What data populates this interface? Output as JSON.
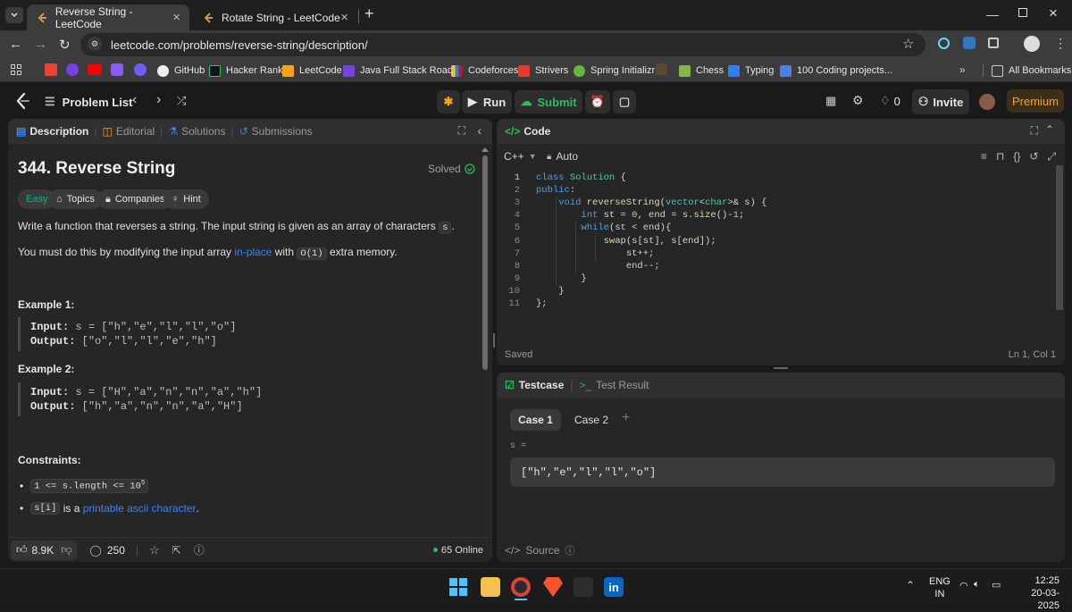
{
  "browser": {
    "tabs": [
      {
        "title": "Reverse String - LeetCode",
        "active": true
      },
      {
        "title": "Rotate String - LeetCode",
        "active": false
      }
    ],
    "url": "leetcode.com/problems/reverse-string/description/",
    "bookmarks": [
      "GitHub",
      "Hacker Rank",
      "LeetCode",
      "Java Full Stack Road...",
      "Codeforces",
      "Strivers",
      "Spring Initializr",
      "Chess",
      "Typing",
      "100 Coding projects..."
    ],
    "all_bookmarks": "All Bookmarks"
  },
  "lc": {
    "problem_list": "Problem List",
    "run": "Run",
    "submit": "Submit",
    "streak": "0",
    "invite": "Invite",
    "premium": "Premium"
  },
  "left": {
    "tabs": [
      "Description",
      "Editorial",
      "Solutions",
      "Submissions"
    ],
    "title": "344. Reverse String",
    "solved": "Solved",
    "tags": {
      "difficulty": "Easy",
      "topics": "Topics",
      "companies": "Companies",
      "hint": "Hint"
    },
    "p1_before": "Write a function that reverses a string. The input string is given as an array of characters ",
    "p1_code": "s",
    "p1_after": ".",
    "p2_before": "You must do this by modifying the input array ",
    "p2_link": "in-place",
    "p2_mid": " with ",
    "p2_code": "O(1)",
    "p2_after": " extra memory.",
    "ex1_title": "Example 1:",
    "ex1_input_label": "Input:",
    "ex1_input": "s = [\"h\",\"e\",\"l\",\"l\",\"o\"]",
    "ex1_output_label": "Output:",
    "ex1_output": "[\"o\",\"l\",\"l\",\"e\",\"h\"]",
    "ex2_title": "Example 2:",
    "ex2_input_label": "Input:",
    "ex2_input": "s = [\"H\",\"a\",\"n\",\"n\",\"a\",\"h\"]",
    "ex2_output_label": "Output:",
    "ex2_output": "[\"h\",\"a\",\"n\",\"n\",\"a\",\"H\"]",
    "constraints_title": "Constraints:",
    "c1": "1 <= s.length <= 10",
    "c1_sup": "5",
    "c2_code": "s[i]",
    "c2_mid": " is a ",
    "c2_link": "printable ascii character",
    "c2_after": ".",
    "likes": "8.9K",
    "comments": "250",
    "online": "65 Online"
  },
  "editor": {
    "header": "Code",
    "language": "C++",
    "mode": "Auto",
    "lines": [
      "class Solution {",
      "public:",
      "    void reverseString(vector<char>& s) {",
      "        int st = 0, end = s.size()-1;",
      "        while(st < end){",
      "            swap(s[st], s[end]);",
      "                st++;",
      "                end--;",
      "        }",
      "    }",
      "};"
    ],
    "line_numbers": [
      "1",
      "2",
      "3",
      "4",
      "5",
      "6",
      "7",
      "8",
      "9",
      "10",
      "11"
    ],
    "saved": "Saved",
    "cursor": "Ln 1, Col 1"
  },
  "testcase": {
    "tab_testcase": "Testcase",
    "tab_result": "Test Result",
    "case1": "Case 1",
    "case2": "Case 2",
    "var_label": "s =",
    "value": "[\"h\",\"e\",\"l\",\"l\",\"o\"]",
    "source": "Source"
  },
  "taskbar": {
    "lang": "ENG",
    "region": "IN",
    "time": "12:25",
    "date": "20-03-2025"
  },
  "colors": {
    "accent": "#ffa116",
    "easy": "#00b8a3",
    "green": "#2cbb5d",
    "link": "#3b82f6"
  }
}
